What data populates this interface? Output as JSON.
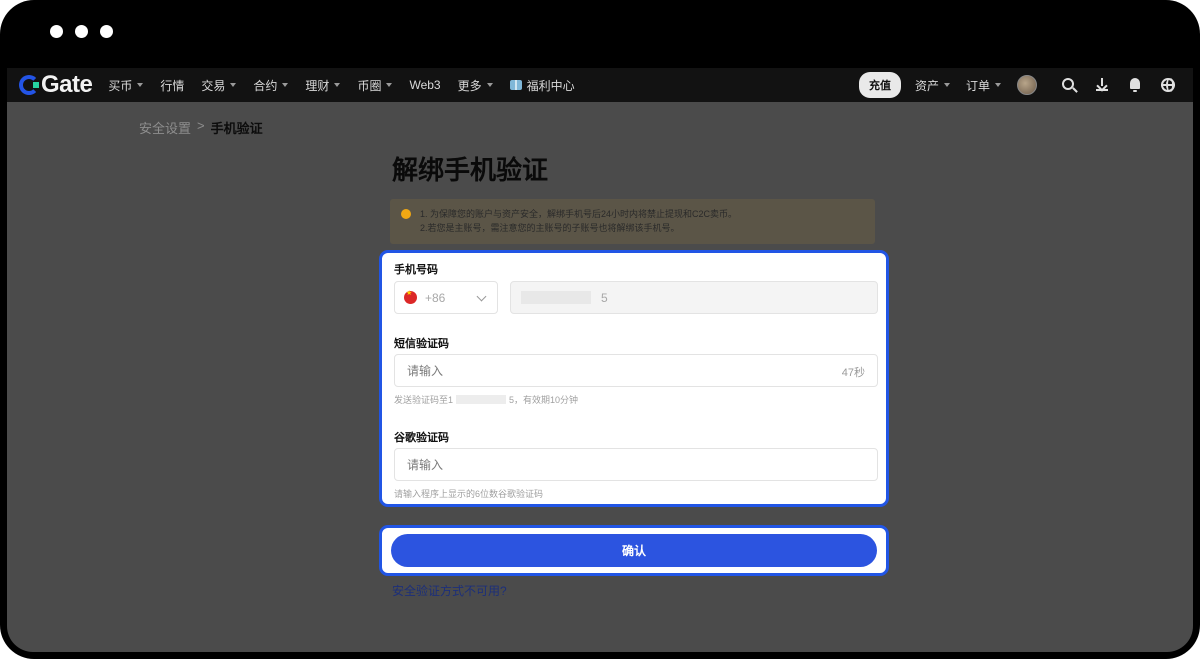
{
  "window": {
    "controls": [
      "close",
      "minimize",
      "maximize"
    ]
  },
  "nav": {
    "logo": "Gate",
    "items": [
      {
        "label": "买币",
        "caret": true
      },
      {
        "label": "行情",
        "caret": false
      },
      {
        "label": "交易",
        "caret": true
      },
      {
        "label": "合约",
        "caret": true
      },
      {
        "label": "理财",
        "caret": true
      },
      {
        "label": "币圈",
        "caret": true
      },
      {
        "label": "Web3",
        "caret": false
      },
      {
        "label": "更多",
        "caret": true
      },
      {
        "label": "福利中心",
        "caret": false,
        "icon": "gift-icon"
      }
    ],
    "recharge": "充值",
    "assets": "资产",
    "orders": "订单",
    "icons": [
      "search-icon",
      "download-icon",
      "bell-icon",
      "globe-icon"
    ]
  },
  "breadcrumb": {
    "parent": "安全设置",
    "separator": ">",
    "current": "手机验证"
  },
  "page": {
    "title": "解绑手机验证"
  },
  "notice": {
    "line1": "1. 为保障您的账户与资产安全，解绑手机号后24小时内将禁止提现和C2C卖币。",
    "line2": "2.若您是主账号，需注意您的主账号的子账号也将解绑该手机号。"
  },
  "form": {
    "phone_label": "手机号码",
    "country_code": "+86",
    "phone_suffix": "5",
    "sms_label": "短信验证码",
    "sms_placeholder": "请输入",
    "sms_countdown": "47秒",
    "sms_hint_prefix": "发送验证码至1",
    "sms_hint_suffix": "5，有效期10分钟",
    "google_label": "谷歌验证码",
    "google_placeholder": "请输入",
    "google_hint": "请输入程序上显示的6位数谷歌验证码"
  },
  "actions": {
    "confirm": "确认",
    "help_link": "安全验证方式不可用?"
  },
  "colors": {
    "accent": "#2155e5",
    "button": "#2c54e0",
    "link": "#1c2f7a"
  }
}
